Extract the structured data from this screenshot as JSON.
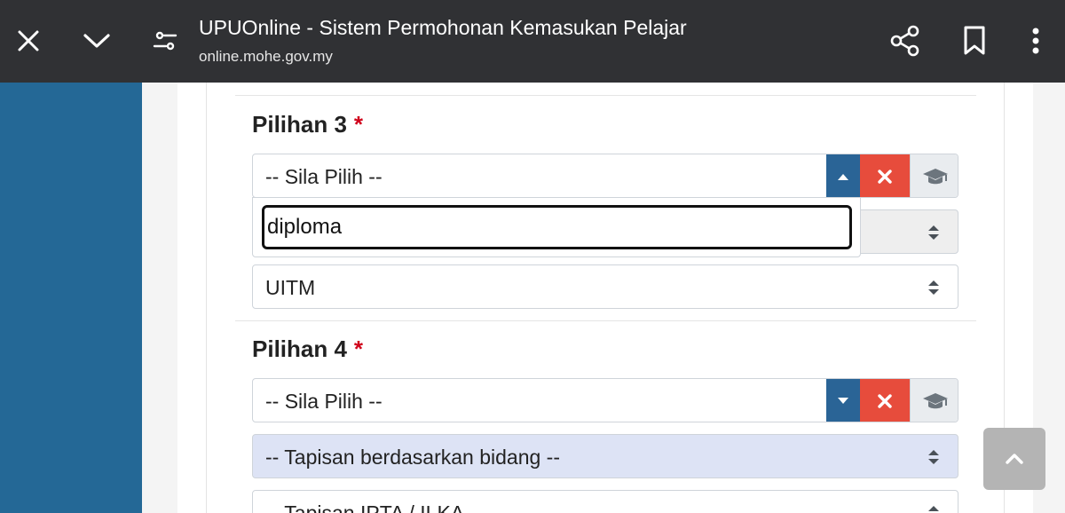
{
  "browser": {
    "title": "UPUOnline - Sistem Permohonan Kemasukan Pelajar",
    "url": "online.mohe.gov.my"
  },
  "pilihan3": {
    "heading": "Pilihan 3",
    "required_mark": "*",
    "course_select": "-- Sila Pilih --",
    "search_value": "diploma",
    "ipta_select": "UITM"
  },
  "pilihan4": {
    "heading": "Pilihan 4",
    "required_mark": "*",
    "course_select": "-- Sila Pilih --",
    "bidang_filter": "-- Tapisan berdasarkan bidang --",
    "ipta_filter": "-- Tapisan IPTA / ILKA --"
  },
  "colors": {
    "accent_blue": "#2a6496",
    "clear_red": "#e74c3c",
    "sidebar_blue": "#246896",
    "highlight_row": "#dde3f5"
  }
}
